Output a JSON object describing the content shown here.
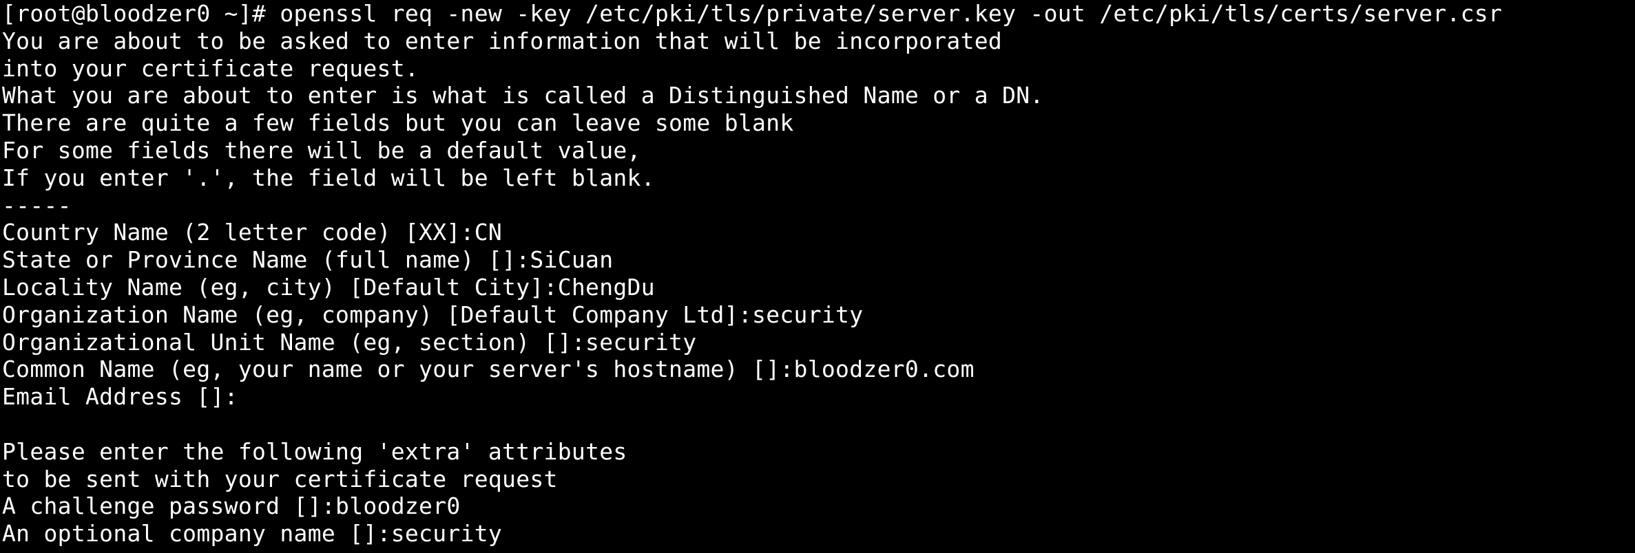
{
  "colors": {
    "background": "#000000",
    "foreground": "#ffffff"
  },
  "terminal": {
    "lines": [
      "[root@bloodzer0 ~]# openssl req -new -key /etc/pki/tls/private/server.key -out /etc/pki/tls/certs/server.csr",
      "You are about to be asked to enter information that will be incorporated",
      "into your certificate request.",
      "What you are about to enter is what is called a Distinguished Name or a DN.",
      "There are quite a few fields but you can leave some blank",
      "For some fields there will be a default value,",
      "If you enter '.', the field will be left blank.",
      "-----",
      "Country Name (2 letter code) [XX]:CN",
      "State or Province Name (full name) []:SiCuan",
      "Locality Name (eg, city) [Default City]:ChengDu",
      "Organization Name (eg, company) [Default Company Ltd]:security",
      "Organizational Unit Name (eg, section) []:security",
      "Common Name (eg, your name or your server's hostname) []:bloodzer0.com",
      "Email Address []:",
      "",
      "Please enter the following 'extra' attributes",
      "to be sent with your certificate request",
      "A challenge password []:bloodzer0",
      "An optional company name []:security"
    ]
  }
}
